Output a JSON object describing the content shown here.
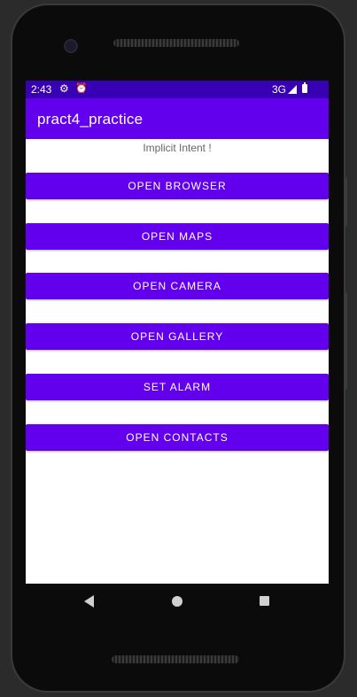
{
  "status_bar": {
    "time": "2:43",
    "network": "3G",
    "settings_icon": "gear-icon",
    "alarm_icon": "alarm-clock-icon",
    "signal_icon": "signal-icon",
    "battery_icon": "battery-icon"
  },
  "app_bar": {
    "title": "pract4_practice"
  },
  "main": {
    "heading": "Implicit Intent !",
    "buttons": [
      {
        "label": "OPEN BROWSER"
      },
      {
        "label": "OPEN MAPS"
      },
      {
        "label": "OPEN CAMERA"
      },
      {
        "label": "OPEN GALLERY"
      },
      {
        "label": "SET ALARM"
      },
      {
        "label": "OPEN CONTACTS"
      }
    ]
  },
  "nav_bar": {
    "back_icon": "back-triangle-icon",
    "home_icon": "home-circle-icon",
    "recents_icon": "recents-square-icon"
  },
  "colors": {
    "status_bar": "#3700b3",
    "primary": "#6200ee",
    "button_text": "#ffffff",
    "heading_text": "#666666"
  }
}
